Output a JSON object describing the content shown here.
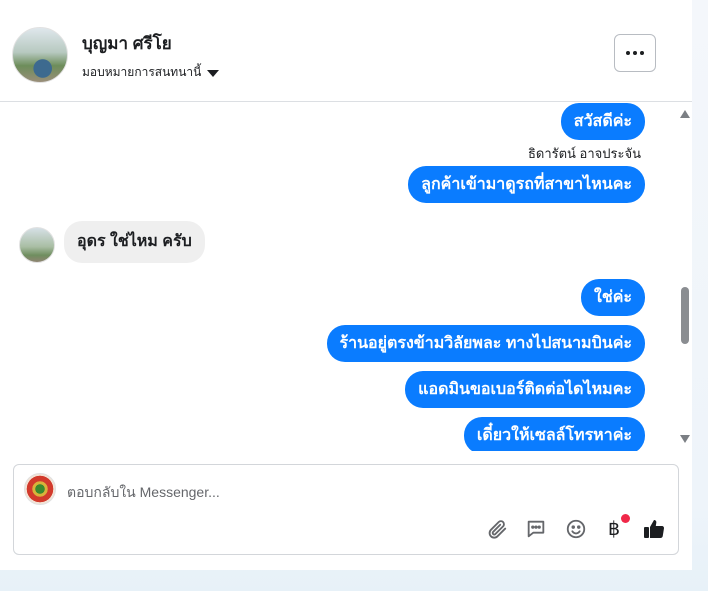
{
  "header": {
    "contact_name": "บุญมา ศรีโย",
    "assign_label": "มอบหมายการสนทนานี้"
  },
  "messages": {
    "m1": "สวัสดีค่ะ",
    "sender_name": "ธิดารัตน์ อาจประจัน",
    "m2": "ลูกค้าเข้ามาดูรถที่สาขาไหนคะ",
    "incoming": "อุดร ใช่ไหม ครับ",
    "m3": "ใช่ค่ะ",
    "m4": "ร้านอยู่ตรงข้ามวิลัยพละ ทางไปสนามบินค่ะ",
    "m5": "แอดมินขอเบอร์ติดต่อไดไหมคะ",
    "m6": "เดี๋ยวให้เซลล์โทรหาค่ะ"
  },
  "composer": {
    "placeholder": "ตอบกลับใน Messenger...",
    "icons": [
      "paperclip-icon",
      "chat-bubble-icon",
      "smiley-icon",
      "baht-icon",
      "thumbs-up-icon"
    ]
  },
  "colors": {
    "outgoing_bubble": "#0a7cff",
    "incoming_bubble": "#efefef",
    "notification_dot": "#f02849"
  }
}
